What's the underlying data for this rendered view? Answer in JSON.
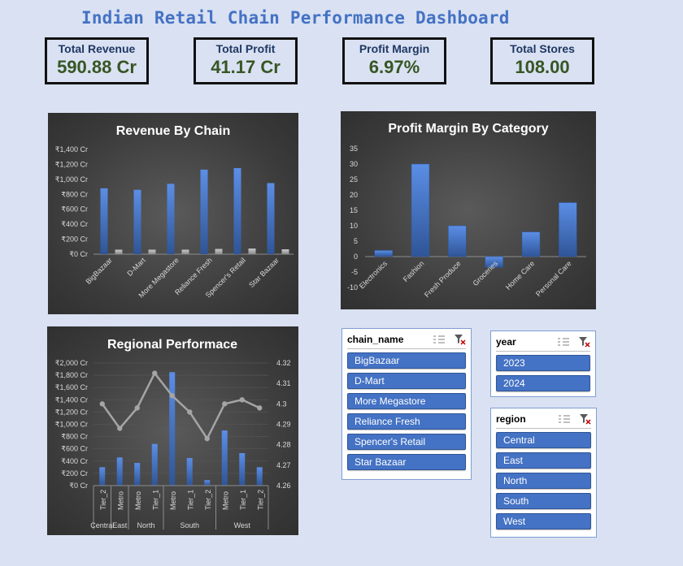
{
  "dashboard": {
    "title": "Indian Retail Chain Performance Dashboard"
  },
  "kpis": [
    {
      "label": "Total Revenue",
      "value": "590.88 Cr"
    },
    {
      "label": "Total Profit",
      "value": "41.17 Cr"
    },
    {
      "label": "Profit Margin",
      "value": "6.97%"
    },
    {
      "label": "Total Stores",
      "value": "108.00"
    }
  ],
  "colors": {
    "bar": "#4472c4",
    "bar2": "#a5a5a5",
    "line": "#a5a5a5",
    "kpi_value": "#375623",
    "title": "#4472c4"
  },
  "chart_data": [
    {
      "type": "bar",
      "title": "Revenue By Chain",
      "categories": [
        "BigBazaar",
        "D-Mart",
        "More Megastore",
        "Reliance Fresh",
        "Spencer's Retail",
        "Star Bazaar"
      ],
      "series": [
        {
          "values": [
            880,
            860,
            940,
            1130,
            1150,
            950
          ]
        },
        {
          "values": [
            60,
            60,
            60,
            70,
            75,
            65
          ]
        }
      ],
      "ylim": [
        0,
        1400
      ],
      "yticks": [
        "₹0 Cr",
        "₹200 Cr",
        "₹400 Cr",
        "₹600 Cr",
        "₹800 Cr",
        "₹1,000 Cr",
        "₹1,200 Cr",
        "₹1,400 Cr"
      ]
    },
    {
      "type": "bar",
      "title": "Profit Margin By Category",
      "categories": [
        "Electronics",
        "Fashion",
        "Fresh Produce",
        "Groceries",
        "Home Care",
        "Personal Care"
      ],
      "values": [
        2,
        30,
        10,
        -3.5,
        8,
        17.5
      ],
      "ylim": [
        -10,
        35
      ],
      "yticks": [
        "-10",
        "-5",
        "0",
        "5",
        "10",
        "15",
        "20",
        "25",
        "30",
        "35"
      ]
    },
    {
      "type": "bar+line",
      "title": "Regional Performace",
      "categories": [
        "Tier_2",
        "Metro",
        "Metro",
        "Tier_1",
        "Metro",
        "Tier_1",
        "Tier_2",
        "Metro",
        "Tier_1",
        "Tier_2"
      ],
      "groups": [
        {
          "label": "Central",
          "count": 1
        },
        {
          "label": "East",
          "count": 1
        },
        {
          "label": "North",
          "count": 2
        },
        {
          "label": "South",
          "count": 3
        },
        {
          "label": "West",
          "count": 3
        }
      ],
      "bar_values": [
        300,
        460,
        370,
        680,
        1850,
        450,
        90,
        900,
        530,
        300
      ],
      "line_values": [
        4.3,
        4.288,
        4.298,
        4.315,
        4.304,
        4.296,
        4.283,
        4.3,
        4.302,
        4.298
      ],
      "ylim": [
        0,
        2000
      ],
      "y2lim": [
        4.26,
        4.32
      ],
      "yticks": [
        "₹0 Cr",
        "₹200 Cr",
        "₹400 Cr",
        "₹600 Cr",
        "₹800 Cr",
        "₹1,000 Cr",
        "₹1,200 Cr",
        "₹1,400 Cr",
        "₹1,600 Cr",
        "₹1,800 Cr",
        "₹2,000 Cr"
      ],
      "y2ticks": [
        "4.26",
        "4.27",
        "4.28",
        "4.29",
        "4.3",
        "4.31",
        "4.32"
      ]
    }
  ],
  "slicers": {
    "chain": {
      "title": "chain_name",
      "items": [
        "BigBazaar",
        "D-Mart",
        "More Megastore",
        "Reliance Fresh",
        "Spencer's Retail",
        "Star Bazaar"
      ]
    },
    "year": {
      "title": "year",
      "items": [
        "2023",
        "2024"
      ]
    },
    "region": {
      "title": "region",
      "items": [
        "Central",
        "East",
        "North",
        "South",
        "West"
      ]
    }
  },
  "icons": {
    "multiselect": "multi-select-icon",
    "clear": "clear-filter-icon"
  }
}
